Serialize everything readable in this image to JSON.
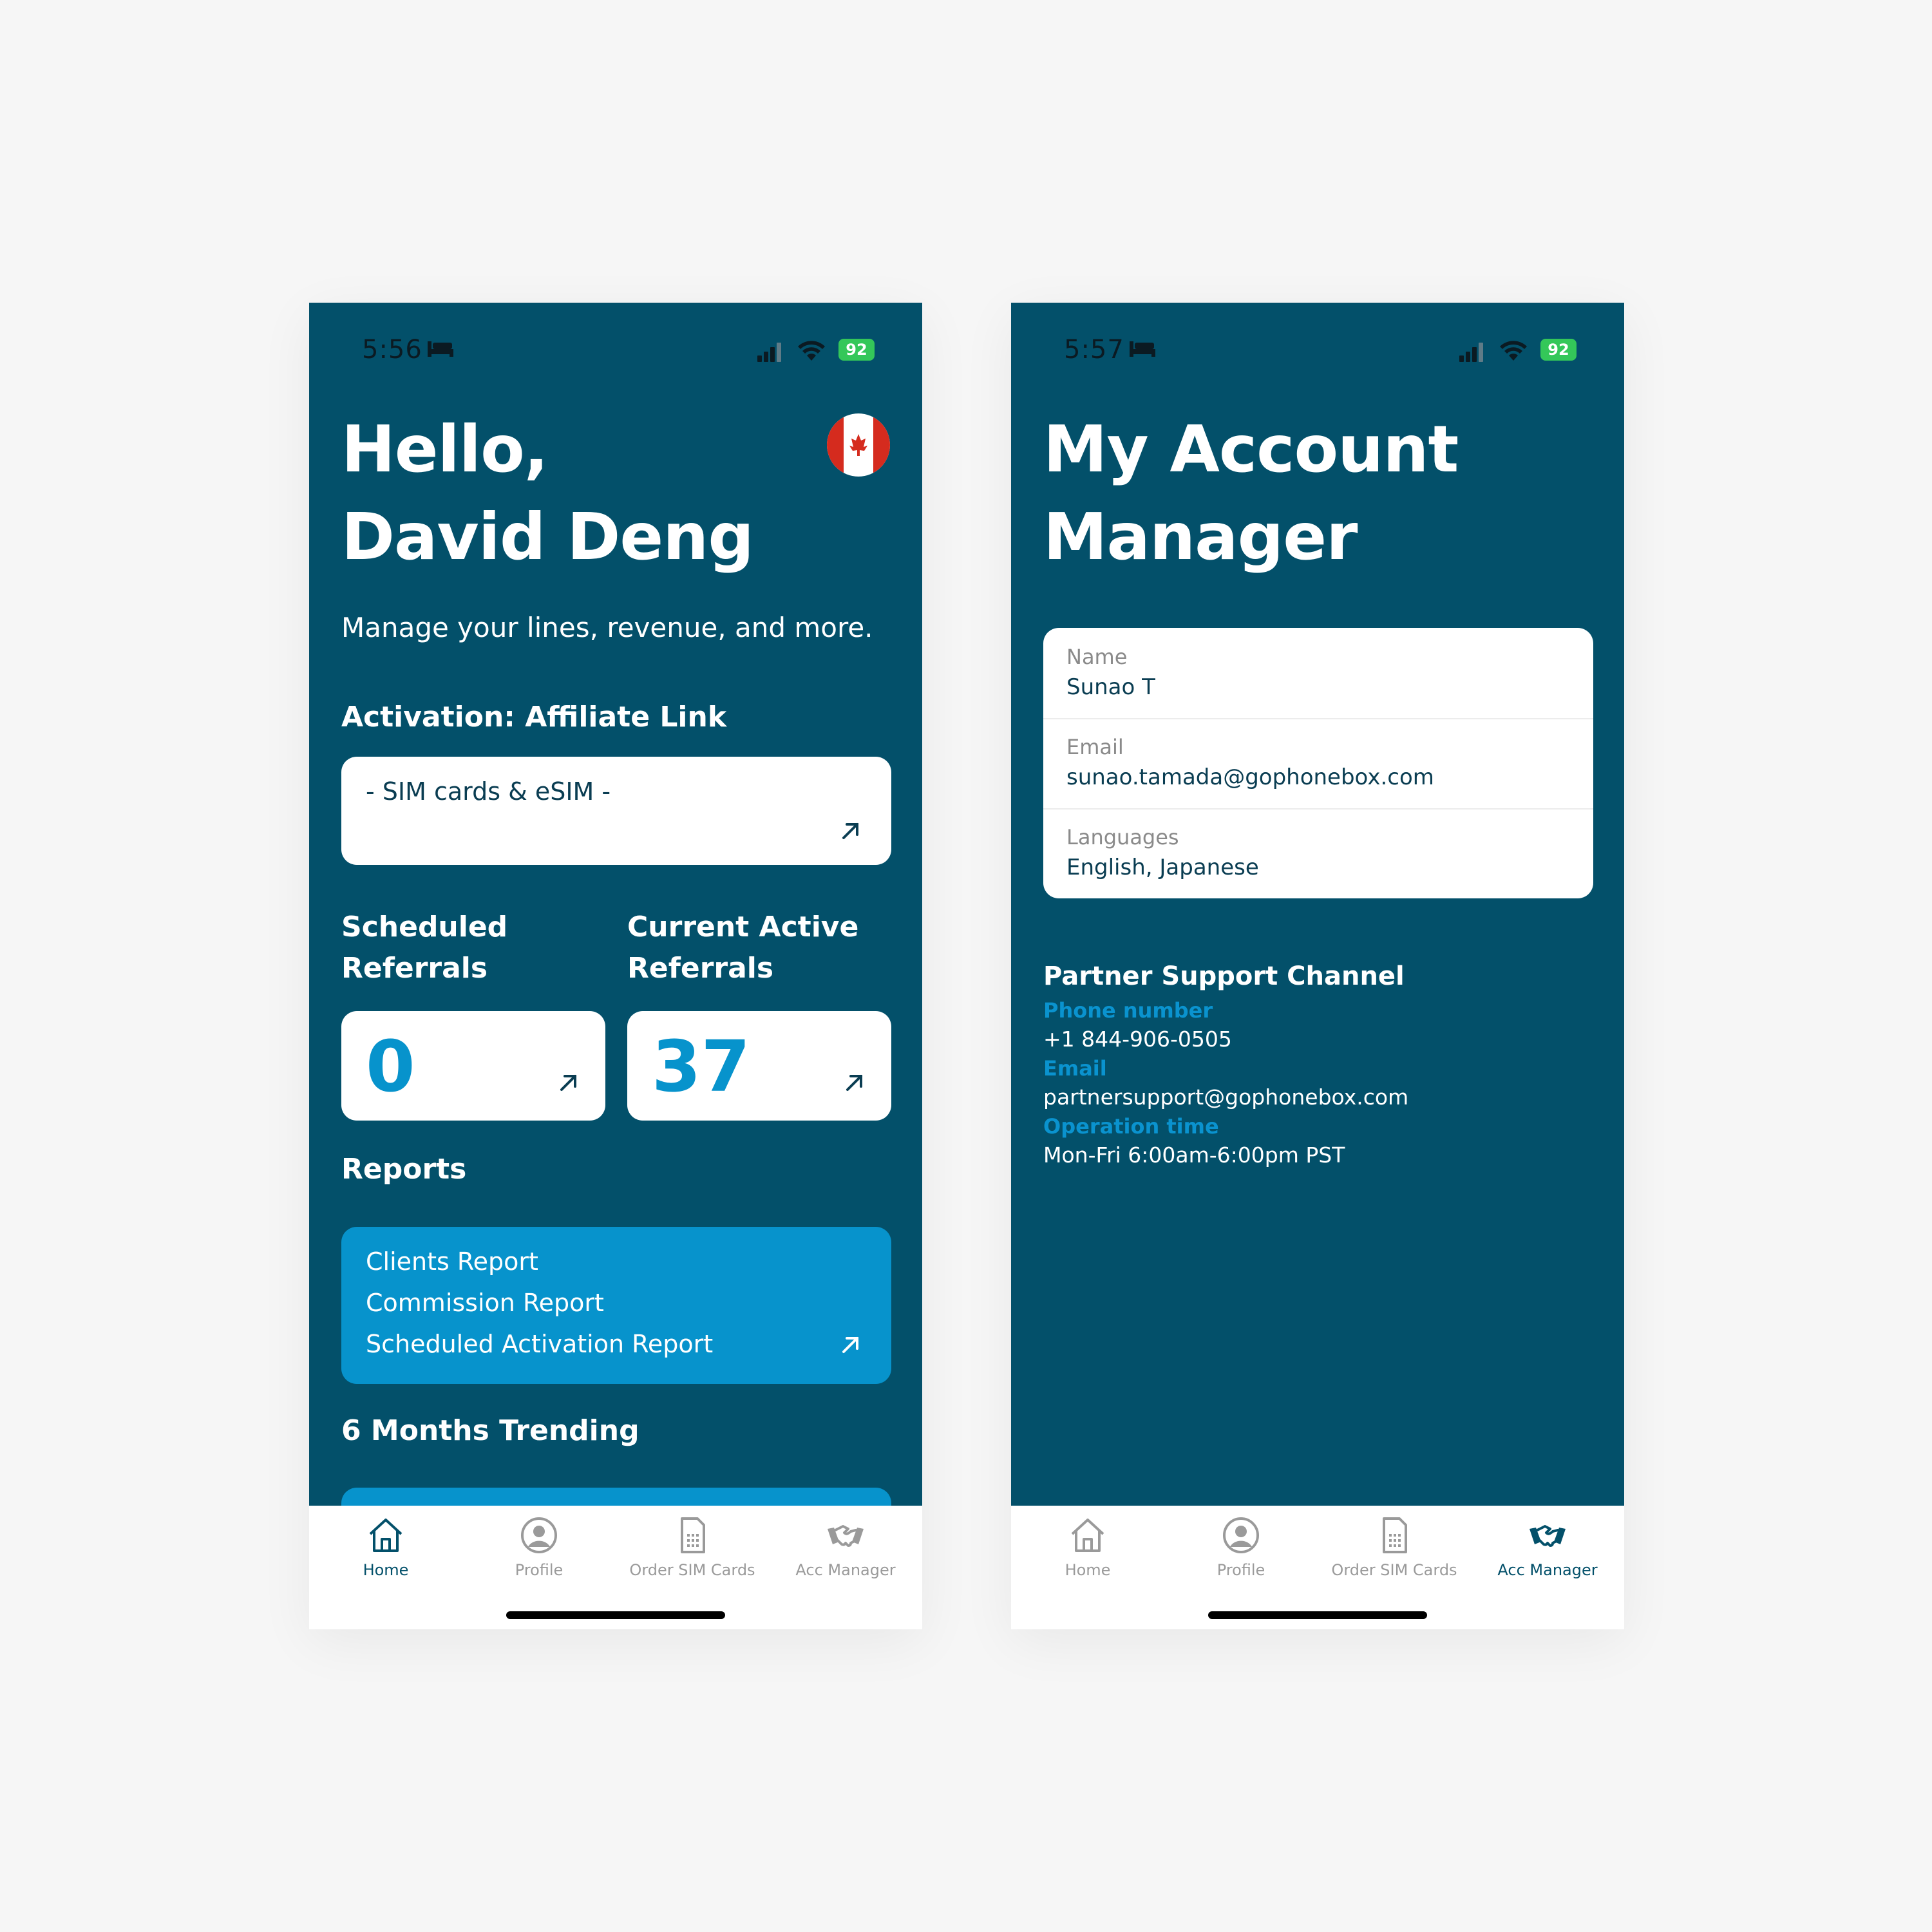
{
  "home": {
    "status": {
      "time": "5:56",
      "battery": "92"
    },
    "greeting_line1": "Hello,",
    "greeting_line2": "David Deng",
    "subtitle": "Manage your lines, revenue, and more.",
    "activation": {
      "title": "Activation: Affiliate Link",
      "link_text": "- SIM cards & eSIM -"
    },
    "scheduled": {
      "title_line1": "Scheduled",
      "title_line2": "Referrals",
      "value": "0"
    },
    "current": {
      "title_line1": "Current Active",
      "title_line2": "Referrals",
      "value": "37"
    },
    "reports": {
      "title": "Reports",
      "items": [
        "Clients Report",
        "Commission Report",
        "Scheduled Activation Report"
      ]
    },
    "trending_title": "6 Months Trending",
    "active_tab": "Home"
  },
  "manager": {
    "status": {
      "time": "5:57",
      "battery": "92"
    },
    "title_line1": "My Account",
    "title_line2": "Manager",
    "card": {
      "name_label": "Name",
      "name_value": "Sunao T",
      "email_label": "Email",
      "email_value": "sunao.tamada@gophonebox.com",
      "languages_label": "Languages",
      "languages_value": "English, Japanese"
    },
    "support": {
      "title": "Partner Support Channel",
      "phone_label": "Phone number",
      "phone_value": "+1 844-906-0505",
      "email_label": "Email",
      "email_value": "partnersupport@gophonebox.com",
      "hours_label": "Operation time",
      "hours_value": "Mon-Fri 6:00am-6:00pm PST"
    },
    "active_tab": "Acc Manager"
  },
  "tabs": [
    {
      "label": "Home",
      "icon": "home-icon"
    },
    {
      "label": "Profile",
      "icon": "profile-icon"
    },
    {
      "label": "Order SIM Cards",
      "icon": "sim-card-icon"
    },
    {
      "label": "Acc Manager",
      "icon": "handshake-icon"
    }
  ],
  "colors": {
    "background": "#f6f6f6",
    "screen": "#03506a",
    "accent": "#0793cc",
    "card": "#ffffff",
    "battery": "#34c759"
  }
}
